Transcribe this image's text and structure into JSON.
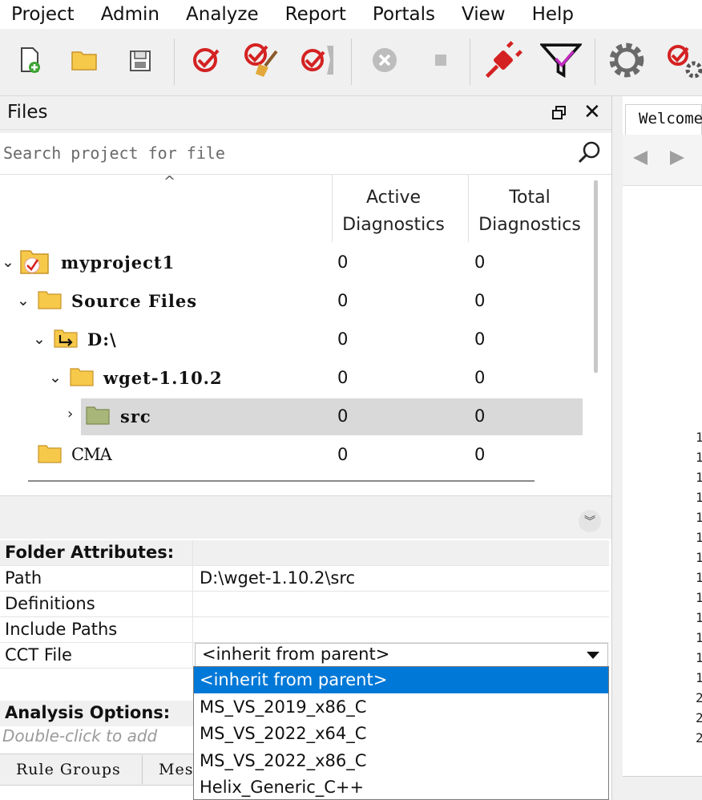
{
  "menu": [
    "Project",
    "Admin",
    "Analyze",
    "Report",
    "Portals",
    "View",
    "Help"
  ],
  "toolbar": {
    "buttons": [
      "new-file-icon",
      "open-folder-icon",
      "save-icon",
      "run-analysis-icon",
      "clean-analysis-icon",
      "run-incremental-icon",
      "cancel-icon",
      "stop-icon",
      "connect-icon",
      "filter-icon",
      "settings-icon",
      "analysis-settings-icon"
    ]
  },
  "files_panel": {
    "title": "Files",
    "search_placeholder": "Search project for file",
    "columns": {
      "active_line1": "Active",
      "active_line2": "Diagnostics",
      "total_line1": "Total",
      "total_line2": "Diagnostics"
    },
    "rows": [
      {
        "name": "myproject1",
        "active": "0",
        "total": "0"
      },
      {
        "name": "Source Files",
        "active": "0",
        "total": "0"
      },
      {
        "name": "D:\\",
        "active": "0",
        "total": "0"
      },
      {
        "name": "wget-1.10.2",
        "active": "0",
        "total": "0"
      },
      {
        "name": "src",
        "active": "0",
        "total": "0"
      },
      {
        "name": "CMA",
        "active": "0",
        "total": "0"
      }
    ]
  },
  "attributes": {
    "folder_header": "Folder Attributes:",
    "path_label": "Path",
    "path_value": "D:\\wget-1.10.2\\src",
    "definitions_label": "Definitions",
    "include_label": "Include Paths",
    "cct_label": "CCT File",
    "cct_value": "<inherit from parent>",
    "analysis_header": "Analysis Options:",
    "hint": "Double-click to add"
  },
  "dropdown": {
    "options": [
      "<inherit from parent>",
      "MS_VS_2019_x86_C",
      "MS_VS_2022_x64_C",
      "MS_VS_2022_x86_C",
      "Helix_Generic_C++"
    ],
    "selected_index": 0
  },
  "bottom_tabs": [
    "Rule Groups",
    "Mes"
  ],
  "right_pane": {
    "tab_label": "Welcome",
    "line_marks": [
      "1",
      "1",
      "1",
      "1",
      "1",
      "1",
      "1",
      "1",
      "1",
      "1",
      "1",
      "1",
      "1",
      "2",
      "2",
      "2"
    ]
  },
  "colors": {
    "selection_blue": "#0078d7",
    "tree_selected": "#d9d9d9",
    "folder_yellow": "#f6c94a",
    "src_folder_green": "#a8b67a"
  }
}
